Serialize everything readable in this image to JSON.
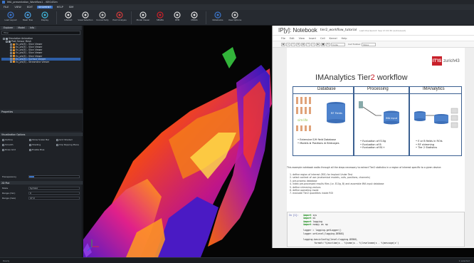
{
  "window": {
    "title": "IMA_presentation_Workflow1 - iSEG4Sim"
  },
  "menubar": {
    "items": [
      "FILE",
      "VIEW",
      "EDIT",
      "SEGMENT",
      "HELP",
      "SIM"
    ],
    "active": "SEGMENT"
  },
  "toolbar": {
    "buttons": [
      {
        "label": "Load Layout",
        "icon": "layout-icon"
      },
      {
        "label": "Mesh Tree",
        "icon": "tree-icon"
      },
      {
        "label": "Display",
        "icon": "display-icon"
      },
      {
        "label": "Interact",
        "icon": "interact-icon"
      },
      {
        "label": "Voxel Selection",
        "icon": "selection-icon"
      },
      {
        "label": "Connectivity",
        "icon": "connect-icon"
      },
      {
        "label": "Point Analysis",
        "icon": "analysis-icon"
      },
      {
        "label": "Model Viewer",
        "icon": "model-icon"
      },
      {
        "label": "SEGMA",
        "icon": "segma-icon"
      },
      {
        "label": "DEM",
        "icon": "dem-icon"
      },
      {
        "label": "MIDAS",
        "icon": "midas-icon"
      },
      {
        "label": "Notebooks",
        "icon": "notebook-icon"
      },
      {
        "label": "View Options",
        "icon": "options-icon"
      }
    ]
  },
  "leftpanel": {
    "tabs": [
      "Explorer",
      "Model",
      "Info"
    ],
    "filter_placeholder": "Filter",
    "tree": [
      "Simulation Animation",
      "Post Sensor Mesh",
      "Ex_phi(E) - Slice Viewer",
      "Ex_phi(E) - Slice Viewer",
      "Ex_phi(E) - Slice Viewer",
      "Ex_phi(E) - Slice Viewer",
      "Ex_phi(E) - Slice Viewer",
      "Ex_phi(E) - Surface Viewer",
      "Ex_phi(E) - Streamline Viewer"
    ],
    "properties_header": "Properties",
    "vis_header": "Visualization Options",
    "options": [
      "Outline",
      "Show Scalar Bar",
      "Grid Shaded",
      "Smooth",
      "Shading",
      "Clip Slipping Plane",
      "Draw Grid",
      "Enable Bias"
    ],
    "transparency_label": "Transparency",
    "prop_header": "2D Plot",
    "rows": [
      {
        "k": "Mode",
        "v": "Symbol"
      },
      {
        "k": "Range (min)",
        "v": "0"
      },
      {
        "k": "Range (max)",
        "v": "47.0"
      }
    ]
  },
  "notebook": {
    "logo": "IP[y]: Notebook",
    "title": "tier2_workflow_tutorial",
    "checkpoint": "Last Checkpoint: Sep 13 20:30 (autosaved)",
    "menu": [
      "File",
      "Edit",
      "View",
      "Insert",
      "Cell",
      "Kernel",
      "Help"
    ],
    "cell_type": "Code",
    "toolbar_label": "Cell Toolbar:",
    "toolbar_value": "None",
    "brand": "zurich43",
    "brand_mark": "IT'IS",
    "workflow_title_a": "IMAnalytics Tier",
    "workflow_title_b": "2",
    "workflow_title_c": " workflow",
    "panel_database": "Database",
    "panel_processing": "Processing",
    "panel_imanalytics": "IMAnalytics",
    "db_bullets": [
      "Extensive E/H field Database",
      "Models ⊗ Positions ⊗ Birdcages"
    ],
    "proc_bullets": [
      "Evaluation of E10g",
      "Evaluation of B",
      "Evaluation of B1+"
    ],
    "ima_bullets": [
      "E or B fields in ROIs",
      "RF shimming",
      "Tier 2 Statistics"
    ],
    "rf_fields": "RF Fields",
    "ima_input": "IMA input",
    "description": "This example notebook walks through all the steps necessary to extract Tier2 statistics in a region of interest specific to a given device:",
    "steps": [
      "define region of interest (ROI) for Implant Under Test",
      "select context of use (anatomical models, coils, positions, channels)",
      "pre-process database",
      "index pre-processed results files (i.e. E10g, B) and assemble IMA input database",
      "define shimming vectors",
      "define operating mode",
      "evaluate Tier2 quantities inside ROI"
    ],
    "prompt": "In [1]:",
    "code": [
      [
        "import",
        "sys"
      ],
      [
        "import",
        "os"
      ],
      [
        "import",
        "logging"
      ],
      [
        "import",
        "numpy as np"
      ],
      [
        "",
        ""
      ],
      [
        "",
        "logger = logging.getLogger()"
      ],
      [
        "",
        "logger.setLevel(logging.DEBUG)"
      ],
      [
        "",
        ""
      ],
      [
        "",
        "logging.basicConfig(level=logging.DEBUG,"
      ],
      [
        "",
        "        format='%(asctime)s - %(name)s - %(levelname)s - %(message)s')"
      ]
    ]
  },
  "statusbar": {
    "left": "Ready",
    "right": "1 selected"
  }
}
